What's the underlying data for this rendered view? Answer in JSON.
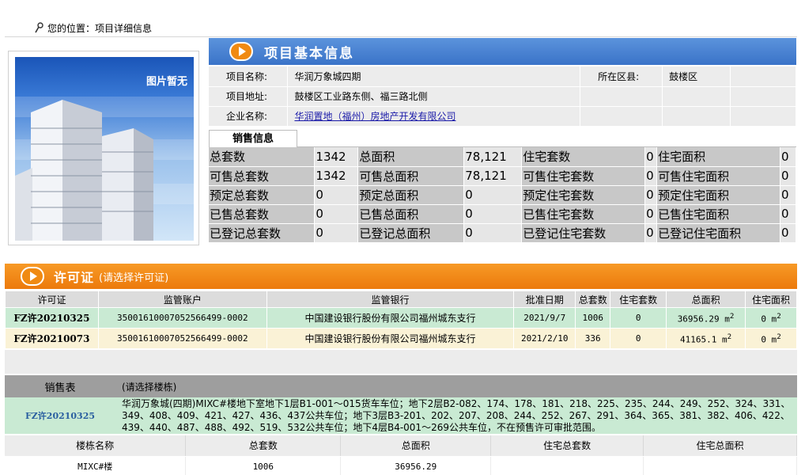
{
  "breadcrumb": {
    "label": "您的位置：项目详细信息"
  },
  "photo": {
    "caption": "图片暂无"
  },
  "basic_info": {
    "title": "项目基本信息",
    "name_label": "项目名称:",
    "name_value": "华润万象城四期",
    "district_label": "所在区县:",
    "district_value": "鼓楼区",
    "address_label": "项目地址:",
    "address_value": "鼓楼区工业路东侧、福三路北侧",
    "company_label": "企业名称:",
    "company_value": "华润置地（福州）房地产开发有限公司"
  },
  "sales_info": {
    "tab_label": "销售信息",
    "rows": [
      [
        "总套数",
        "1342",
        "总面积",
        "78,121",
        "住宅套数",
        "0",
        "住宅面积",
        "0"
      ],
      [
        "可售总套数",
        "1342",
        "可售总面积",
        "78,121",
        "可售住宅套数",
        "0",
        "可售住宅面积",
        "0"
      ],
      [
        "预定总套数",
        "0",
        "预定总面积",
        "0",
        "预定住宅套数",
        "0",
        "预定住宅面积",
        "0"
      ],
      [
        "已售总套数",
        "0",
        "已售总面积",
        "0",
        "已售住宅套数",
        "0",
        "已售住宅面积",
        "0"
      ],
      [
        "已登记总套数",
        "0",
        "已登记总面积",
        "0",
        "已登记住宅套数",
        "0",
        "已登记住宅面积",
        "0"
      ]
    ]
  },
  "permit": {
    "title": "许可证",
    "subtitle": "(请选择许可证)",
    "columns": [
      "许可证",
      "监管账户",
      "监管银行",
      "批准日期",
      "总套数",
      "住宅套数",
      "总面积",
      "住宅面积"
    ],
    "rows": [
      {
        "id": "FZ许20210325",
        "account": "35001610007052566499-0002",
        "bank": "中国建设银行股份有限公司福州城东支行",
        "date": "2021/9/7",
        "total": "1006",
        "res": "0",
        "area": "36956.29 m",
        "res_area": "0 m",
        "sup": "2"
      },
      {
        "id": "FZ许20210073",
        "account": "35001610007052566499-0002",
        "bank": "中国建设银行股份有限公司福州城东支行",
        "date": "2021/2/10",
        "total": "336",
        "res": "0",
        "area": "41165.1 m",
        "res_area": "0 m",
        "sup": "2"
      }
    ]
  },
  "sales_list": {
    "title": "销售表",
    "hint": "(请选择楼栋)",
    "permit_id": "FZ许20210325",
    "description": "华润万象城(四期)MIXC#楼地下室地下1层B1-001～015货车车位；地下2层B2-082、174、178、181、218、225、235、244、249、252、324、331、349、408、409、421、427、436、437公共车位；地下3层B3-201、202、207、208、244、252、267、291、364、365、381、382、406、422、439、440、487、488、492、519、532公共车位；地下4层B4-001～269公共车位，不在预售许可审批范围。",
    "columns": [
      "楼栋名称",
      "总套数",
      "总面积",
      "住宅总套数",
      "住宅总面积"
    ],
    "rows": [
      {
        "name": "MIXC#楼",
        "total": "1006",
        "area": "36956.29",
        "res_total": "",
        "res_area": ""
      }
    ]
  }
}
